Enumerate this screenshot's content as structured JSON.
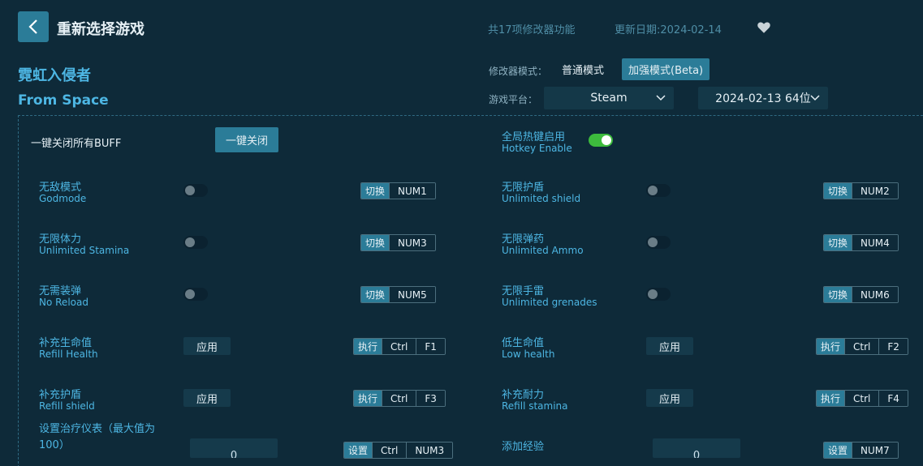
{
  "header": {
    "title": "重新选择游戏",
    "feature_count": "共17项修改器功能",
    "update_date": "更新日期:2024-02-14"
  },
  "game": {
    "name_cn": "霓虹入侵者",
    "name_en": "From Space"
  },
  "mode": {
    "label": "修改器模式：",
    "normal": "普通模式",
    "beta": "加强模式(Beta)"
  },
  "platform": {
    "label": "游戏平台：",
    "selected": "Steam",
    "version": "2024-02-13 64位"
  },
  "buff": {
    "label": "一键关闭所有BUFF",
    "button": "一键关闭"
  },
  "hotkey": {
    "label_cn": "全局热键启用",
    "label_en": "Hotkey Enable",
    "enabled": true
  },
  "options": [
    {
      "cn": "无敌模式",
      "en": "Godmode",
      "tag": "切换",
      "keys": [
        "NUM1"
      ]
    },
    {
      "cn": "无限护盾",
      "en": "Unlimited shield",
      "tag": "切换",
      "keys": [
        "NUM2"
      ]
    },
    {
      "cn": "无限体力",
      "en": "Unlimited Stamina",
      "tag": "切换",
      "keys": [
        "NUM3"
      ]
    },
    {
      "cn": "无限弹药",
      "en": "Unlimited Ammo",
      "tag": "切换",
      "keys": [
        "NUM4"
      ]
    },
    {
      "cn": "无需装弹",
      "en": "No Reload",
      "tag": "切换",
      "keys": [
        "NUM5"
      ]
    },
    {
      "cn": "无限手雷",
      "en": "Unlimited grenades",
      "tag": "切换",
      "keys": [
        "NUM6"
      ]
    },
    {
      "cn": "补充生命值",
      "en": "Refill Health",
      "apply": "应用",
      "tag": "执行",
      "keys": [
        "Ctrl",
        "F1"
      ]
    },
    {
      "cn": "低生命值",
      "en": "Low health",
      "apply": "应用",
      "tag": "执行",
      "keys": [
        "Ctrl",
        "F2"
      ]
    },
    {
      "cn": "补充护盾",
      "en": "Refill shield",
      "apply": "应用",
      "tag": "执行",
      "keys": [
        "Ctrl",
        "F3"
      ]
    },
    {
      "cn": "补充耐力",
      "en": "Refill stamina",
      "apply": "应用",
      "tag": "执行",
      "keys": [
        "Ctrl",
        "F4"
      ]
    },
    {
      "cn": "设置治疗仪表（最大值为100）",
      "value": "0",
      "tag": "设置",
      "keys": [
        "Ctrl",
        "NUM3"
      ]
    },
    {
      "cn": "添加经验",
      "value": "0",
      "tag": "设置",
      "keys": [
        "NUM7"
      ]
    }
  ]
}
